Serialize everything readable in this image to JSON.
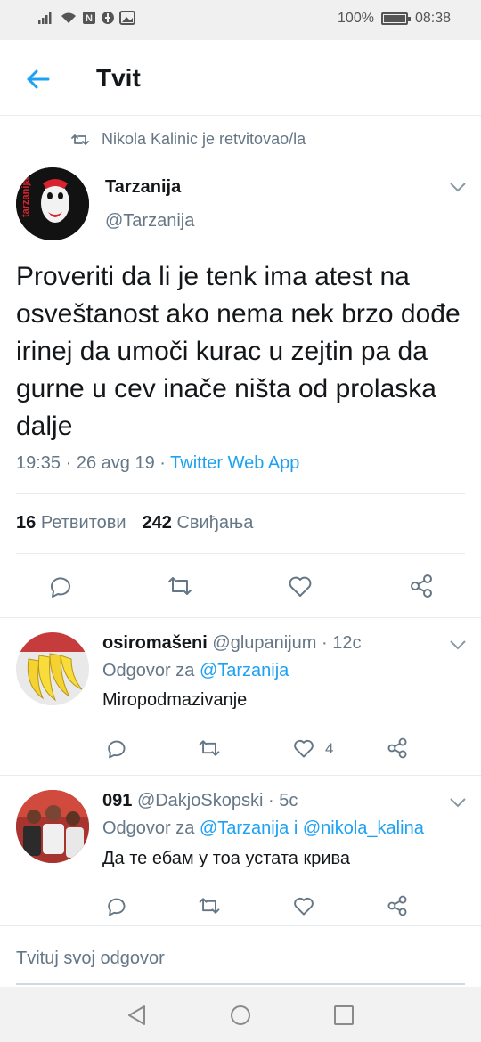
{
  "status_bar": {
    "battery": "100%",
    "time": "08:38"
  },
  "header": {
    "title": "Tvit"
  },
  "retweet_context": {
    "text": "Nikola Kalinic je retvitovao/la"
  },
  "tweet": {
    "author_name": "Tarzanija",
    "author_handle": "@Tarzanija",
    "avatar_text": "tarzanija",
    "text": "Proveriti da li je tenk ima atest na osveštanost ako nema nek brzo dođe irinej da umoči kurac u zejtin pa da gurne u cev inače ništa od prolaska dalje",
    "time": "19:35",
    "date": "26 avg 19",
    "source": "Twitter Web App",
    "retweets_count": "16",
    "retweets_label": "Ретвитови",
    "likes_count": "242",
    "likes_label": "Свиђања"
  },
  "replies": [
    {
      "name": "osiromašeni",
      "handle": "@glupanijum",
      "age": "12c",
      "reply_to_prefix": "Odgovor za",
      "reply_to_1": "@Tarzanija",
      "reply_to_sep": "",
      "reply_to_2": "",
      "text": "Miropodmazivanje",
      "like_count": "4"
    },
    {
      "name": "091",
      "handle": "@DakjoSkopski",
      "age": "5c",
      "reply_to_prefix": "Odgovor za",
      "reply_to_1": "@Tarzanija",
      "reply_to_sep": "i",
      "reply_to_2": "@nikola_kalina",
      "text": "Да те ебам у тоа устата крива",
      "like_count": ""
    }
  ],
  "compose": {
    "placeholder": "Tvituj svoj odgovor"
  },
  "colors": {
    "accent": "#1da1f2",
    "muted": "#657786",
    "text": "#14171a",
    "divider": "#e6ecf0"
  }
}
